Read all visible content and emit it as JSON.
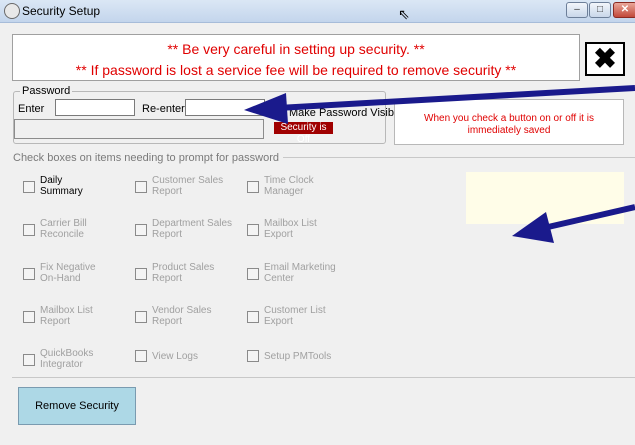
{
  "window": {
    "title": "Security Setup",
    "buttons": {
      "minimize": "–",
      "maximize": "□",
      "close": "✕"
    }
  },
  "warning": {
    "line1": "** Be very careful in setting up security. **",
    "line2": "** If password is lost a service fee will be required to remove security **"
  },
  "close_large_label": "✖",
  "password": {
    "legend": "Password",
    "enter_label": "Enter",
    "reenter_label": "Re-enter",
    "enter_value": "",
    "reenter_value": "",
    "make_visible_label": "Make Password Visible",
    "status": "Security is Off"
  },
  "notice": {
    "line1": "When you check a button on or off it is",
    "line2": "immediately saved"
  },
  "checkbox_header": "Check boxes on items needing to prompt for password",
  "checkboxes": {
    "daily_summary": {
      "l1": "Daily",
      "l2": "Summary"
    },
    "customer_sales": {
      "l1": "Customer Sales",
      "l2": "Report"
    },
    "time_clock": {
      "l1": "Time Clock",
      "l2": "Manager"
    },
    "carrier_bill": {
      "l1": "Carrier Bill",
      "l2": "Reconcile"
    },
    "department_sales": {
      "l1": "Department Sales",
      "l2": "Report"
    },
    "mailbox_list_export": {
      "l1": "Mailbox List",
      "l2": "Export"
    },
    "fix_negative": {
      "l1": "Fix Negative",
      "l2": "On-Hand"
    },
    "product_sales": {
      "l1": "Product Sales",
      "l2": "Report"
    },
    "email_marketing": {
      "l1": "Email Marketing",
      "l2": "Center"
    },
    "mailbox_list_report": {
      "l1": "Mailbox List",
      "l2": "Report"
    },
    "vendor_sales": {
      "l1": "Vendor Sales",
      "l2": "Report"
    },
    "customer_list": {
      "l1": "Customer List",
      "l2": "Export"
    },
    "quickbooks": {
      "l1": "QuickBooks",
      "l2": "Integrator"
    },
    "view_logs": {
      "l1": "View Logs"
    },
    "setup_pmtools": {
      "l1": "Setup PMTools"
    }
  },
  "remove_button": "Remove Security",
  "colors": {
    "warning_red": "#e00000",
    "status_bg": "#a00000",
    "remove_button_bg": "#add8e6",
    "annotation_arrow": "#1a1a8c",
    "highlight_yellow": "#fffde8"
  },
  "icons": [
    "app-icon",
    "close-icon",
    "cursor-icon",
    "arrow-annotation"
  ]
}
